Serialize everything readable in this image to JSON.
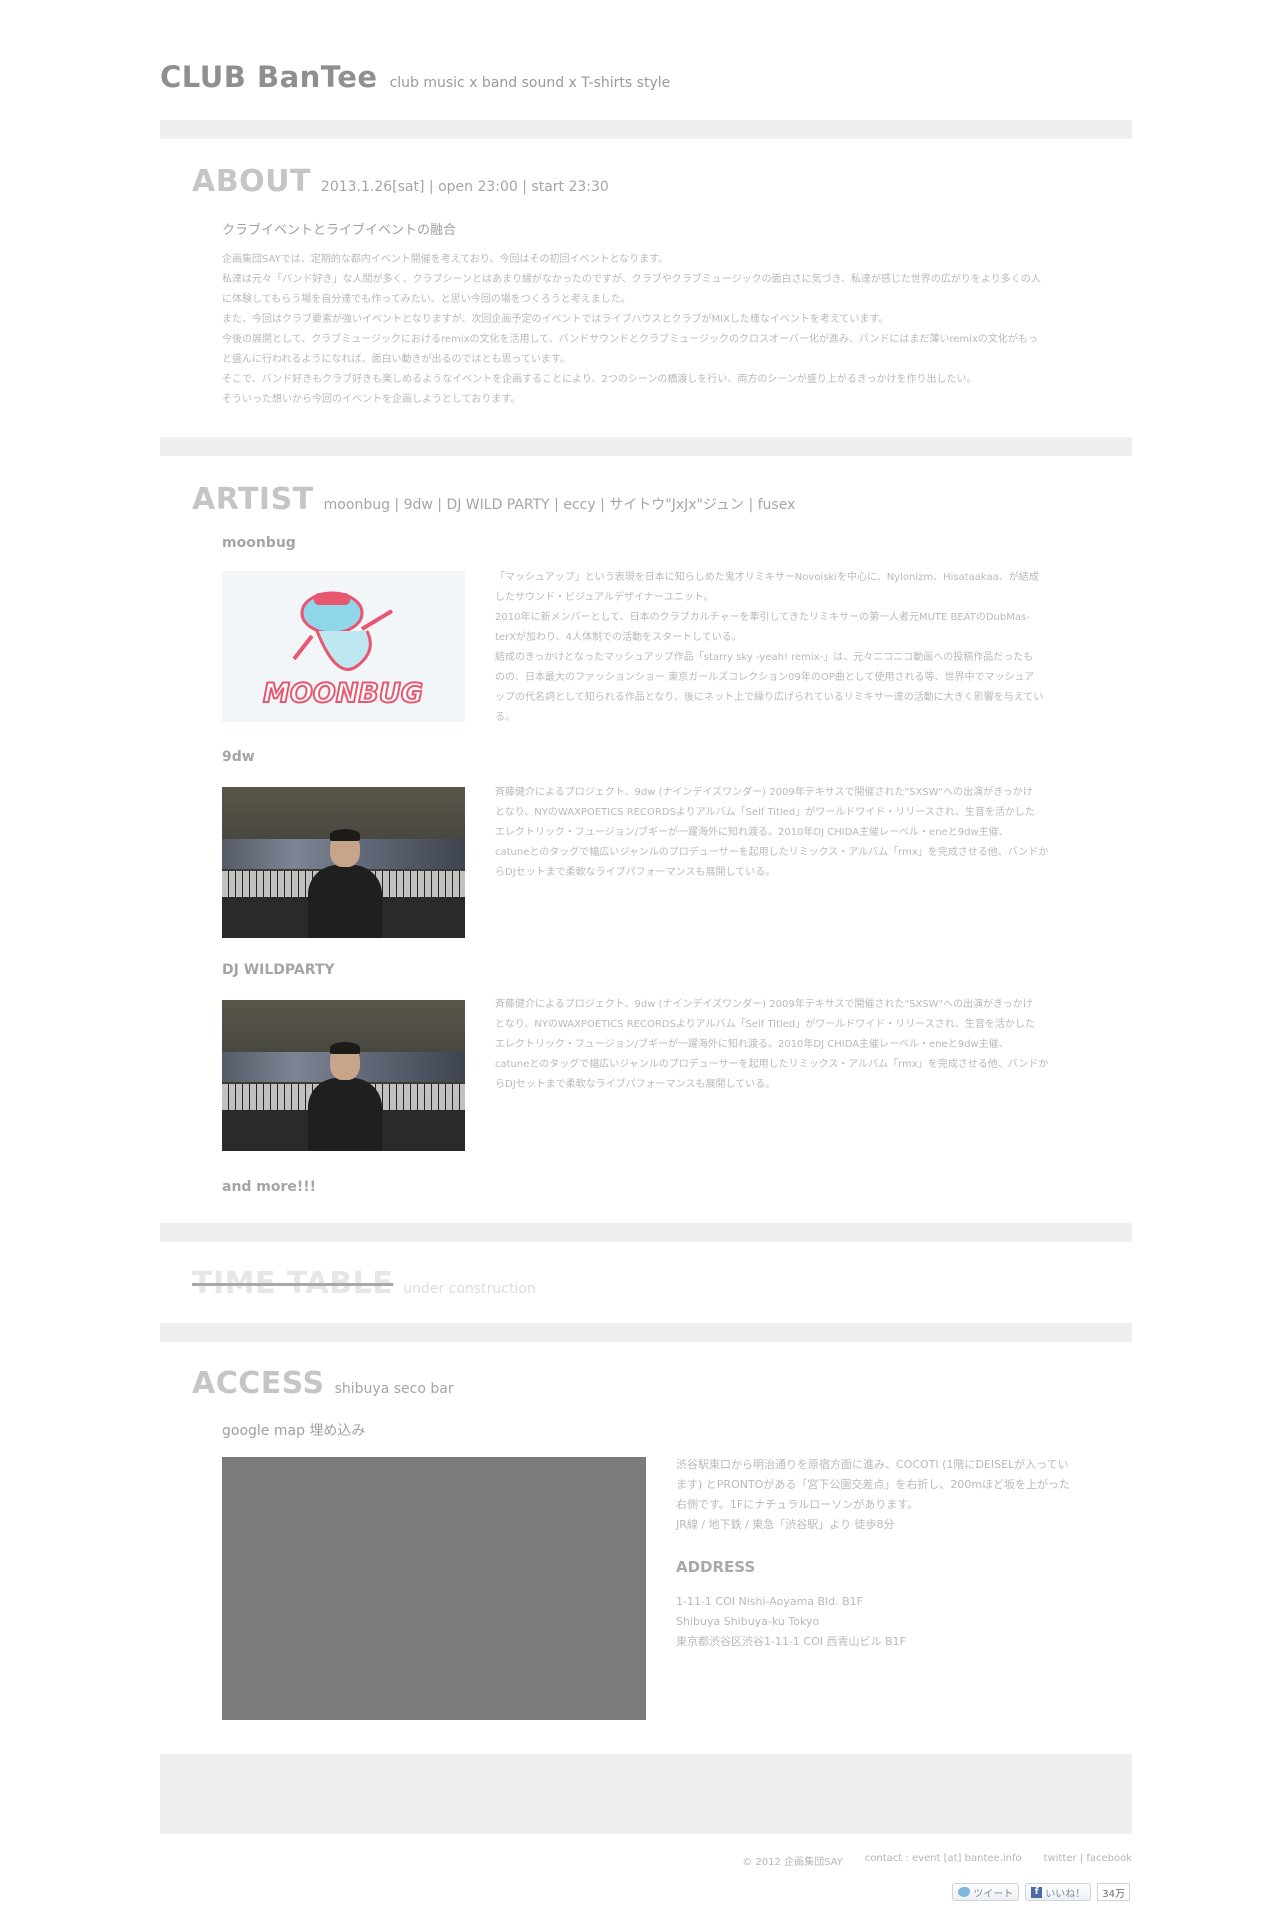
{
  "header": {
    "title": "CLUB BanTee",
    "tagline": "club music x band sound x T-shirts style"
  },
  "about": {
    "title": "ABOUT",
    "sub": "2013.1.26[sat] | open 23:00 | start 23:30",
    "heading": "クラブイベントとライブイベントの融合",
    "lines": [
      "企画集団SAYでは、定期的な都内イベント開催を考えており、今回はその初回イベントとなります。",
      "私達は元々「バンド好き」な人間が多く、クラブシーンとはあまり縁がなかったのですが、クラブやクラブミュージックの面白さに気づき、私達が感じた世界の広がりをより多くの人",
      "に体験してもらう場を自分達でも作ってみたい、と思い今回の場をつくろうと考えました。",
      "また、今回はクラブ要素が強いイベントとなりますが、次回企画予定のイベントではライブハウスとクラブがMIXした様なイベントを考えています。",
      "今後の展開として、クラブミュージックにおけるremixの文化を活用して、バンドサウンドとクラブミュージックのクロスオーバー化が進み、バンドにはまだ薄いremixの文化がもっ",
      "と盛んに行われるようになれば、面白い動きが出るのではとも思っています。",
      "そこで、バンド好きもクラブ好きも楽しめるようなイベントを企画することにより、2つのシーンの橋渡しを行い、両方のシーンが盛り上がるきっかけを作り出したい。",
      "そういった想いから今回のイベントを企画しようとしております。"
    ]
  },
  "artist": {
    "title": "ARTIST",
    "sub": "moonbug | 9dw | DJ WILD PARTY | eccy | サイトウ\"JxJx\"ジュン | fusex",
    "items": [
      {
        "name": "moonbug",
        "logo_text": "MOONBUG",
        "lines": [
          "「マッシュアップ」という表現を日本に知らしめた鬼才リミキサーNovoiskiを中心に、Nylonizm、Hisataakaa、が結成",
          "したサウンド・ビジュアルデザイナーユニット。",
          "2010年に新メンバーとして、日本のクラブカルチャーを牽引してきたリミキサーの第一人者元MUTE BEATのDubMas-",
          "terXが加わり、4人体制での活動をスタートしている。",
          "結成のきっかけとなったマッシュアップ作品「starry sky -yeah! remix-」は、元々ニコニコ動画への投稿作品だったも",
          "のの、日本最大のファッションショー 東京ガールズコレクション09年のOP曲として使用される等、世界中でマッシュア",
          "ップの代名詞として知られる作品となり、後にネット上で繰り広げられているリミキサー達の活動に大きく影響を与えてい",
          "る。"
        ]
      },
      {
        "name": "9dw",
        "lines": [
          "斉藤健介によるプロジェクト、9dw (ナインデイズワンダー) 2009年テキサスで開催された\"SXSW\"への出演がきっかけ",
          "となり、NYのWAXPOETICS RECORDSよりアルバム「Self Titled」がワールドワイド・リリースされ、生音を活かした",
          "エレクトリック・フュージョン/ブギーが一躍海外に知れ渡る。2010年DJ CHIDA主催レーベル・eneと9dw主催、",
          "catuneとのタッグで幅広いジャンルのプロデューサーを起用したリミックス・アルバム「rmx」を完成させる他、バンドか",
          "らDJセットまで柔軟なライブパフォーマンスも展開している。"
        ]
      },
      {
        "name": "DJ WILDPARTY",
        "lines": [
          "斉藤健介によるプロジェクト、9dw (ナインデイズワンダー) 2009年テキサスで開催された\"SXSW\"への出演がきっかけ",
          "となり、NYのWAXPOETICS RECORDSよりアルバム「Self Titled」がワールドワイド・リリースされ、生音を活かした",
          "エレクトリック・フュージョン/ブギーが一躍海外に知れ渡る。2010年DJ CHIDA主催レーベル・eneと9dw主催、",
          "catuneとのタッグで幅広いジャンルのプロデューサーを起用したリミックス・アルバム「rmx」を完成させる他、バンドか",
          "らDJセットまで柔軟なライブパフォーマンスも展開している。"
        ]
      }
    ],
    "more": "and more!!!"
  },
  "timetable": {
    "title": "TIME TABLE",
    "sub": "under construction"
  },
  "access": {
    "title": "ACCESS",
    "sub": "shibuya seco bar",
    "map_label": "google map 埋め込み",
    "lines": [
      "渋谷駅東口から明治通りを原宿方面に進み、COCOTI (1階にDEISELが入ってい",
      "ます) とPRONTOがある「宮下公園交差点」を右折し、200mほど坂を上がった",
      "右側です。1Fにナチュラルローソンがあります。",
      "JR線 / 地下鉄 / 東急「渋谷駅」より 徒歩8分"
    ],
    "address_heading": "ADDRESS",
    "address_lines": [
      "1-11-1 COI Nishi-Aoyama Bld. B1F",
      "Shibuya Shibuya-ku Tokyo",
      "東京都渋谷区渋谷1-11-1 COI 西青山ビル B1F"
    ]
  },
  "footer": {
    "copyright": "© 2012 企画集団SAY",
    "contact": "contact : event [at] bantee.info",
    "links": "twitter | facebook",
    "tweet_label": "ツイート",
    "like_label": "いいね！",
    "like_count": "34万"
  }
}
